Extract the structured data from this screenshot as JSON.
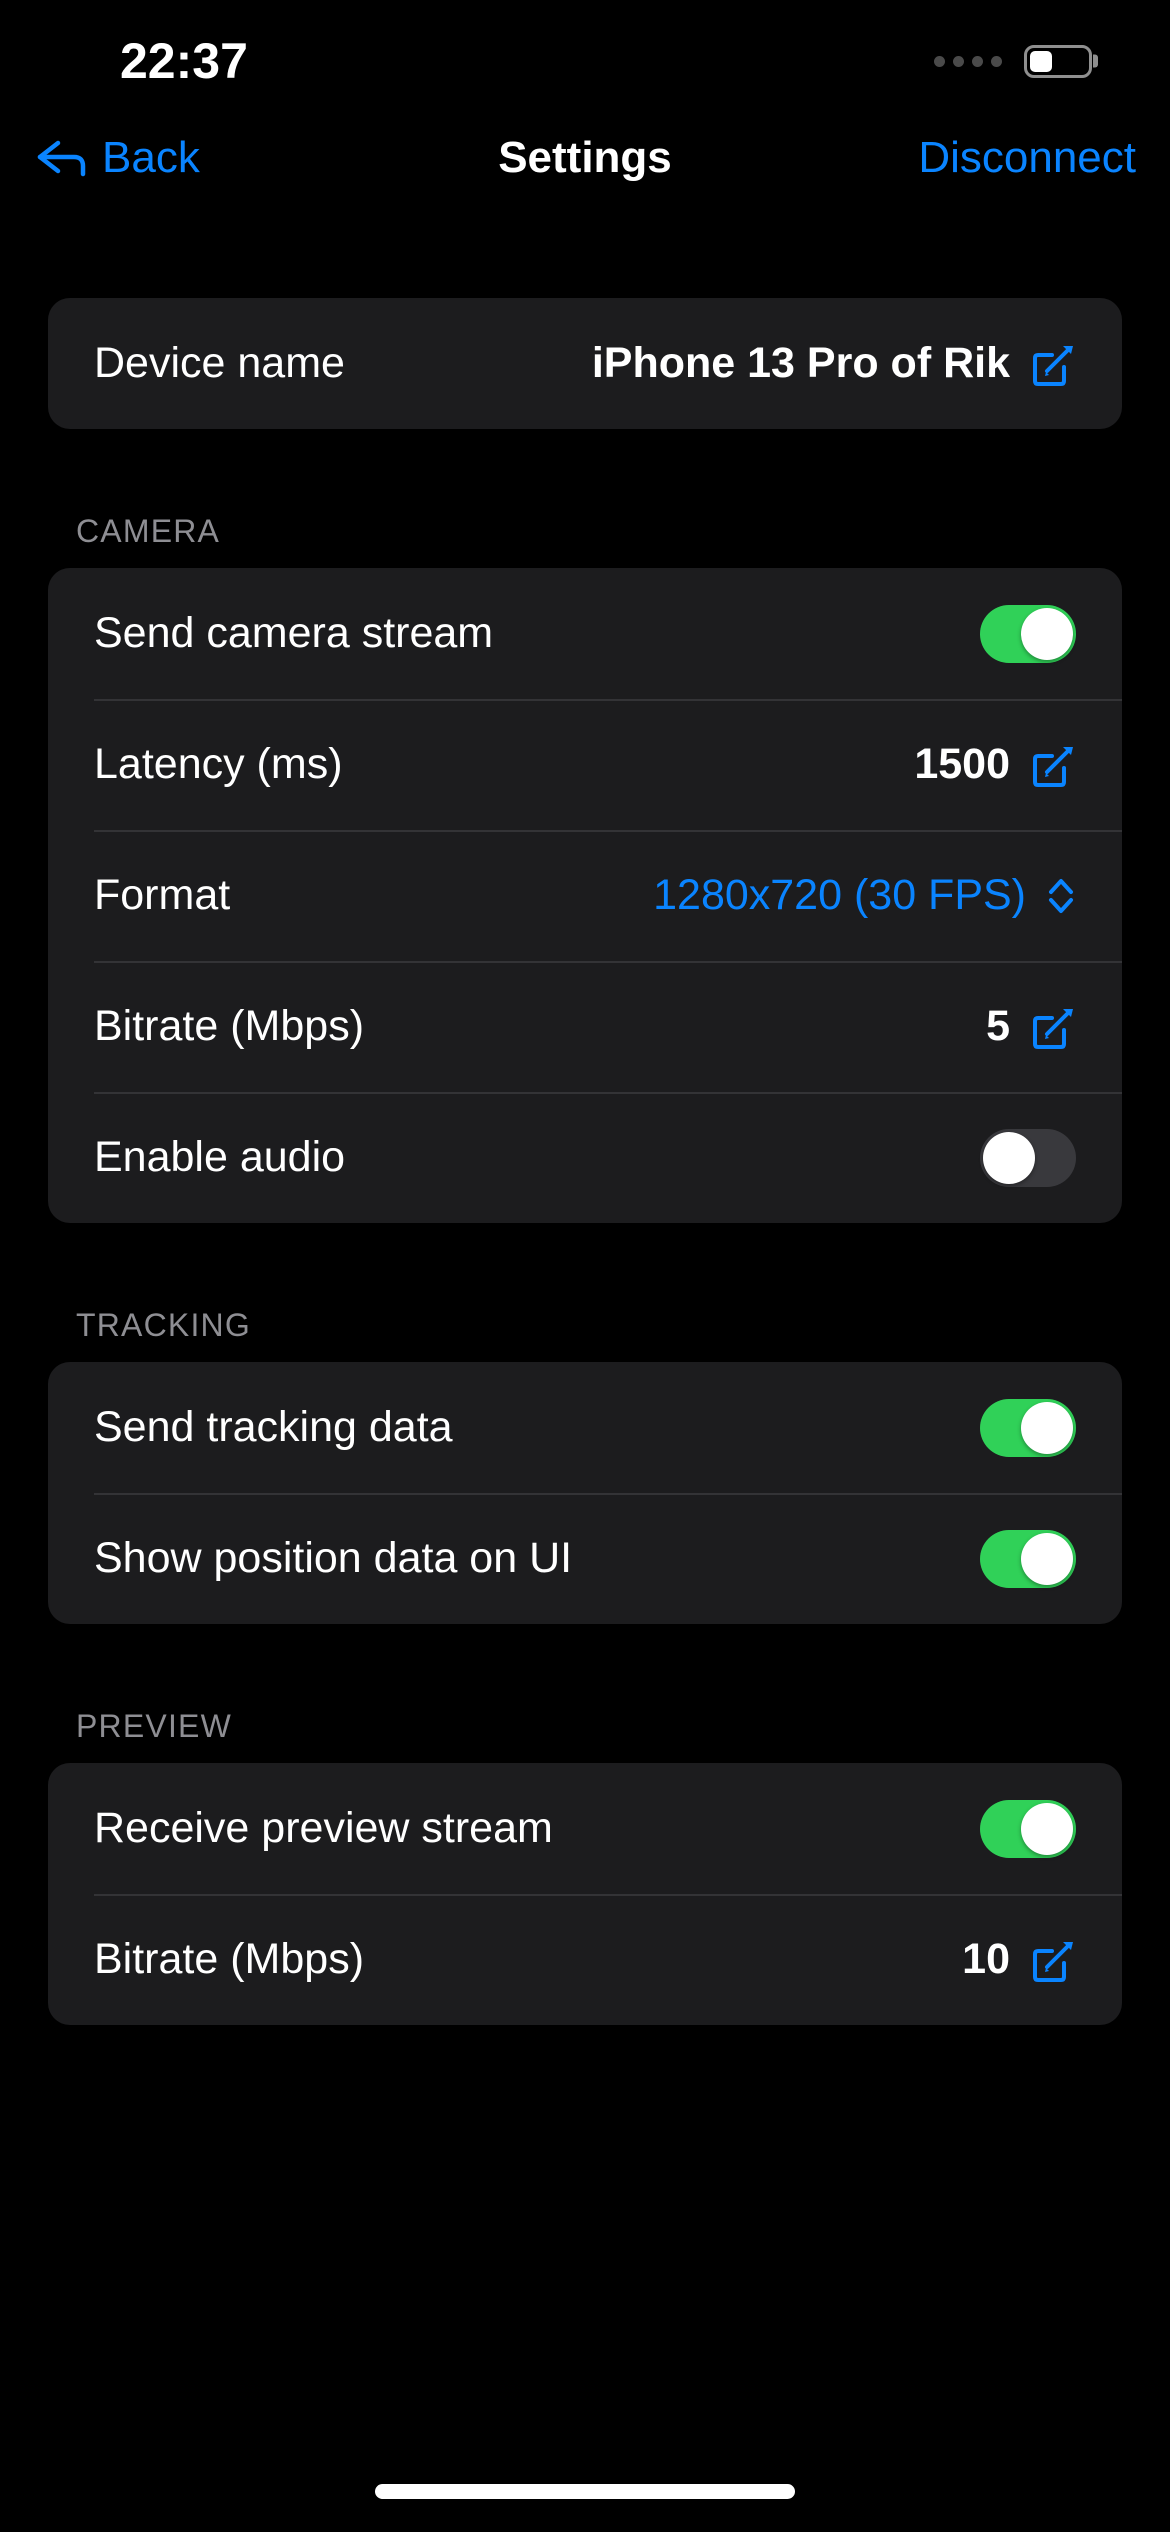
{
  "status_bar": {
    "time": "22:37",
    "battery_level_percent": 40,
    "signal_dots": 4
  },
  "nav": {
    "back_label": "Back",
    "title": "Settings",
    "disconnect_label": "Disconnect",
    "accent_color": "#0a84ff"
  },
  "device": {
    "label": "Device name",
    "value": "iPhone 13 Pro of Rik"
  },
  "sections": [
    {
      "header": "CAMERA",
      "rows": [
        {
          "label": "Send camera stream",
          "type": "toggle",
          "value": "on"
        },
        {
          "label": "Latency (ms)",
          "type": "edit",
          "value": "1500"
        },
        {
          "label": "Format",
          "type": "menu",
          "value": "1280x720 (30 FPS)"
        },
        {
          "label": "Bitrate (Mbps)",
          "type": "edit",
          "value": "5"
        },
        {
          "label": "Enable audio",
          "type": "toggle",
          "value": "off"
        }
      ]
    },
    {
      "header": "TRACKING",
      "rows": [
        {
          "label": "Send tracking data",
          "type": "toggle",
          "value": "on"
        },
        {
          "label": "Show position data on UI",
          "type": "toggle",
          "value": "on"
        }
      ]
    },
    {
      "header": "PREVIEW",
      "rows": [
        {
          "label": "Receive preview stream",
          "type": "toggle",
          "value": "on"
        },
        {
          "label": "Bitrate (Mbps)",
          "type": "edit",
          "value": "10"
        }
      ]
    }
  ],
  "colors": {
    "background": "#000000",
    "card": "#1c1c1e",
    "accent_blue": "#0a84ff",
    "toggle_on": "#30d158",
    "toggle_off": "#39393d",
    "section_header_gray": "#8e8e93"
  },
  "icons": {
    "back": "arrow-uturn-backward-icon",
    "edit": "square-and-pencil-icon",
    "menu": "chevron-up-down-icon"
  }
}
